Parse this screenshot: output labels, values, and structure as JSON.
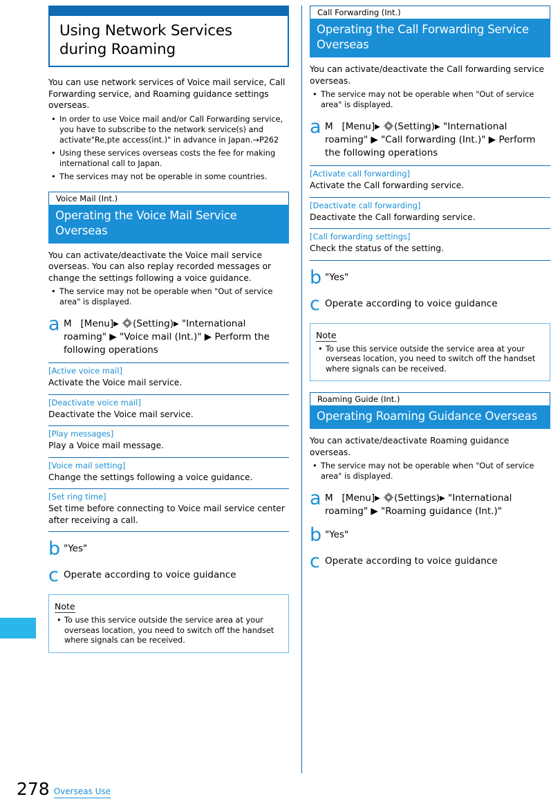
{
  "chapter": {
    "title_line1": "Using Network Services",
    "title_line2": "during Roaming"
  },
  "left": {
    "intro": "You can use network services of Voice mail service, Call Forwarding service, and Roaming guidance settings overseas.",
    "bullets": [
      "In order to use Voice mail and/or Call Forwarding service, you have to subscribe to the network service(s) and activate\"Re,pte access(int.)\" in advance in Japan.→P262",
      "Using these services overseas costs the fee for making international call to Japan.",
      "The services may not be operable in some countries."
    ],
    "section": {
      "label": "Voice Mail (Int.)",
      "title": "Operating the Voice Mail Service Overseas",
      "body": "You can activate/deactivate the Voice mail service overseas. You can also replay recorded messages or change the settings following a voice guidance.",
      "bullets": [
        "The service may not be operable when \"Out of service area\" is displayed."
      ]
    },
    "step_a": {
      "letter": "a",
      "key": "M",
      "menu": "[Menu]",
      "gear_label": "(Setting)",
      "rest": "\"International roaming\" ▶ \"Voice mail (Int.)\" ▶ Perform the following operations"
    },
    "subs": [
      {
        "title": "[Active voice mail]",
        "body": "Activate the Voice mail service."
      },
      {
        "title": "[Deactivate voice mail]",
        "body": "Deactivate the Voice mail service."
      },
      {
        "title": "[Play messages]",
        "body": "Play a Voice mail message."
      },
      {
        "title": "[Voice mail setting]",
        "body": "Change the settings following a voice guidance."
      },
      {
        "title": "[Set ring time]",
        "body": "Set time before connecting to Voice mail service center after receiving a call."
      }
    ],
    "step_b": {
      "letter": "b",
      "text": "\"Yes\""
    },
    "step_c": {
      "letter": "c",
      "text": "Operate according to voice guidance"
    },
    "note": {
      "title": "Note",
      "items": [
        "To use this service outside the service area at your overseas location, you need to switch off the handset where signals can be received."
      ]
    }
  },
  "right": {
    "section1": {
      "label": "Call Forwarding (Int.)",
      "title": "Operating the Call Forwarding Service Overseas",
      "body": "You can activate/deactivate the Call forwarding service overseas.",
      "bullets": [
        "The service may not be operable when \"Out of service area\" is displayed."
      ],
      "step_a": {
        "letter": "a",
        "key": "M",
        "menu": "[Menu]",
        "gear_label": "(Setting)",
        "rest": "\"International roaming\" ▶ \"Call forwarding (Int.)\" ▶ Perform the following operations"
      },
      "subs": [
        {
          "title": "[Activate call forwarding]",
          "body": "Activate the Call forwarding service."
        },
        {
          "title": "[Deactivate call forwarding]",
          "body": "Deactivate the Call forwarding service."
        },
        {
          "title": "[Call forwarding settings]",
          "body": "Check the status of the setting."
        }
      ],
      "step_b": {
        "letter": "b",
        "text": "\"Yes\""
      },
      "step_c": {
        "letter": "c",
        "text": "Operate according to voice guidance"
      },
      "note": {
        "title": "Note",
        "items": [
          "To use this service outside the service area at your overseas location, you need to switch off the handset where signals can be received."
        ]
      }
    },
    "section2": {
      "label": "Roaming Guide (Int.)",
      "title": "Operating Roaming Guidance Overseas",
      "body": "You can activate/deactivate Roaming guidance overseas.",
      "bullets": [
        "The service may not be operable when \"Out of service area\" is displayed."
      ],
      "step_a": {
        "letter": "a",
        "key": "M",
        "menu": "[Menu]",
        "gear_label": "(Settings)",
        "rest": "\"International roaming\" ▶ \"Roaming guidance (Int.)\""
      },
      "step_b": {
        "letter": "b",
        "text": "\"Yes\""
      },
      "step_c": {
        "letter": "c",
        "text": "Operate according to voice guidance"
      }
    }
  },
  "footer": {
    "page_number": "278",
    "label": "Overseas Use"
  },
  "colors": {
    "accent_blue": "#1b8fd6",
    "rule_blue": "#0f6ab4",
    "tab": "#29b6e8"
  }
}
